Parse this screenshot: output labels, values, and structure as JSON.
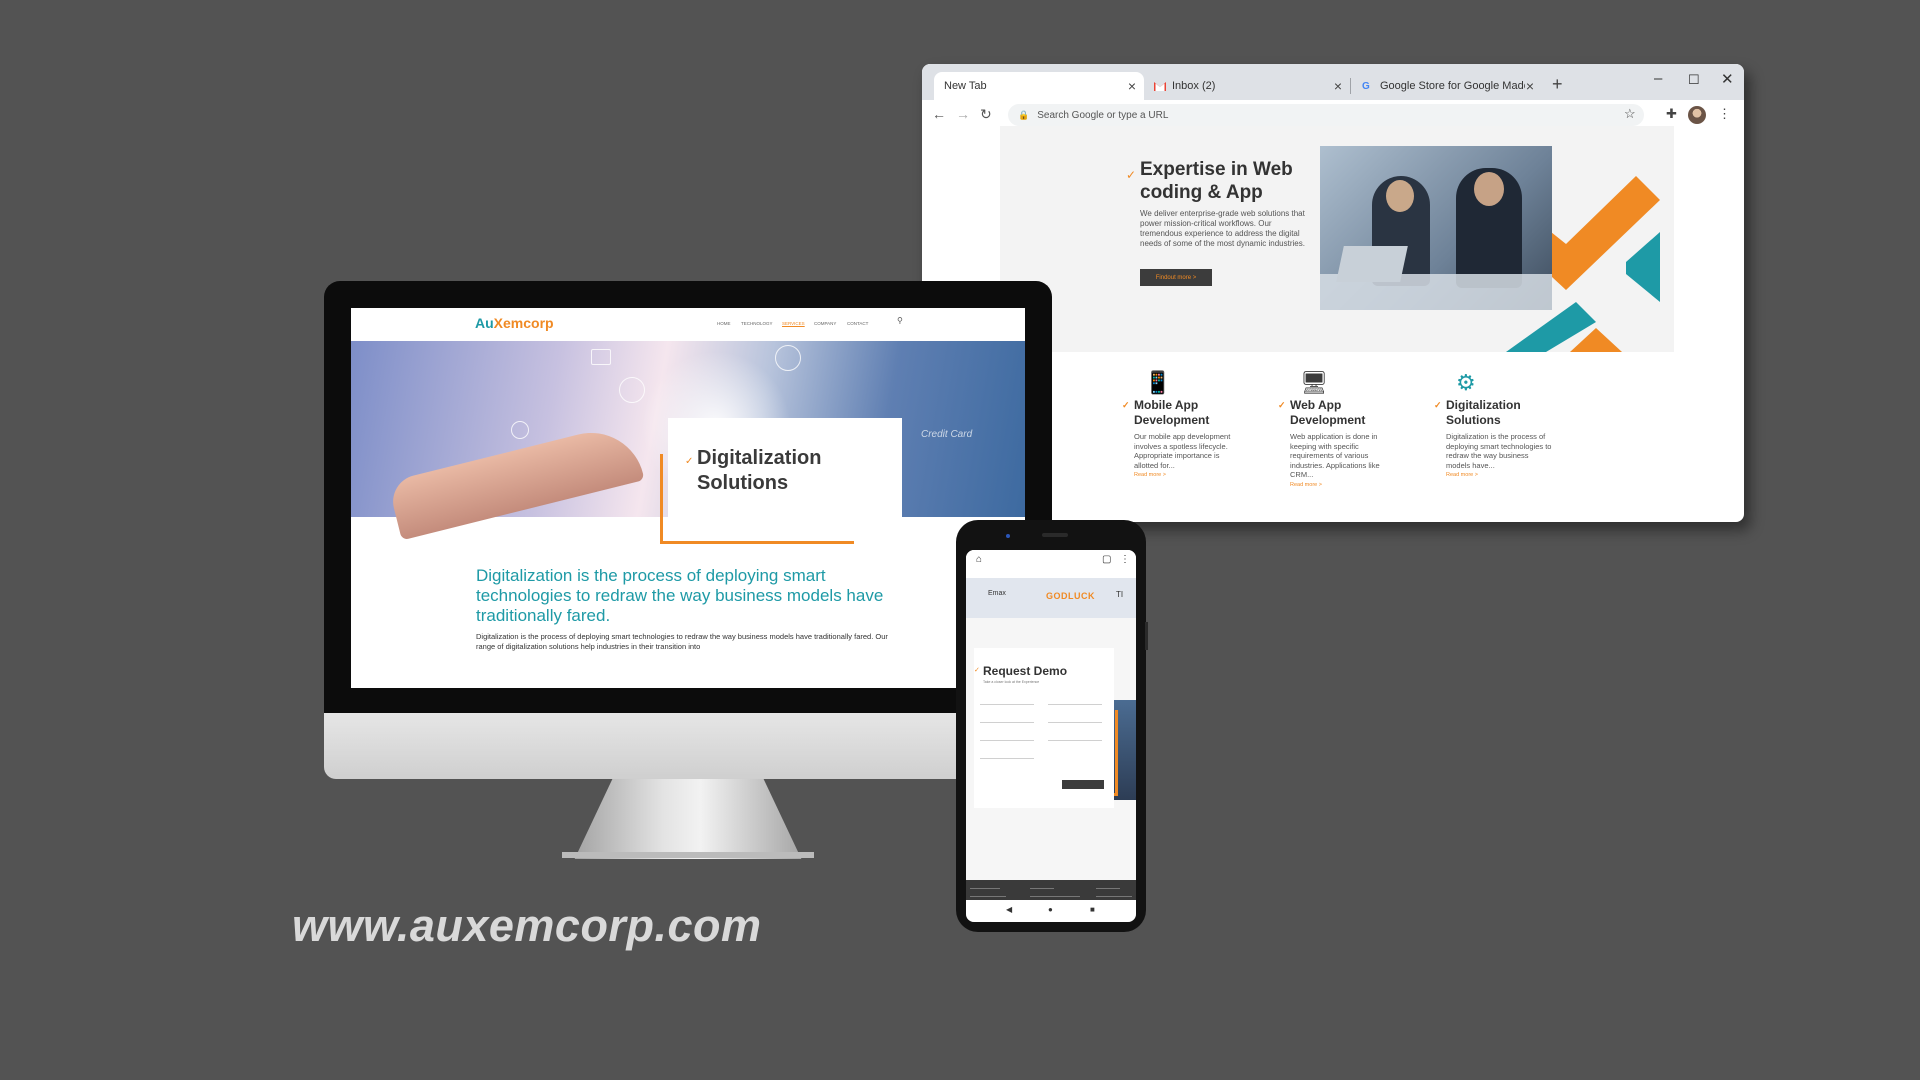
{
  "colors": {
    "background": "#535353",
    "accent_orange": "#f08a24",
    "accent_teal": "#1e9aa6",
    "dark": "#3c3c3c"
  },
  "browser": {
    "tabs": [
      {
        "label": "New Tab",
        "icon": "none"
      },
      {
        "label": "Inbox (2)",
        "icon": "gmail-icon"
      },
      {
        "label": "Google Store for Google Made",
        "icon": "google-icon"
      }
    ],
    "omnibox_placeholder": "Search Google or type a URL",
    "hero": {
      "title": "Expertise in Web coding & App",
      "text": "We deliver enterprise-grade web solutions that power mission-critical workflows. Our tremendous experience to address the digital needs of some of the most dynamic industries.",
      "button": "Findout more >"
    },
    "services": [
      {
        "icon": "mobile-icon",
        "title": "Mobile App Development",
        "text": "Our mobile app development involves a spotless lifecycle. Appropriate importance is allotted for...",
        "more": "Read more >"
      },
      {
        "icon": "monitor-code-icon",
        "title": "Web App Development",
        "text": "Web application is done in keeping with specific requirements of various industries. Applications like CRM...",
        "more": "Read more >"
      },
      {
        "icon": "gear-icon",
        "title": "Digitalization Solutions",
        "text": "Digitalization is the process of deploying smart technologies to redraw the way business models have...",
        "more": "Read more >"
      }
    ]
  },
  "imac": {
    "logo": {
      "prefix": "Au",
      "rest": "Xemcorp"
    },
    "nav": [
      "HOME",
      "TECHNOLOGY",
      "SERVICES",
      "COMPANY",
      "CONTACT"
    ],
    "nav_active": "SERVICES",
    "hero_card_text": "Credit Card",
    "card_title": "Digitalization Solutions",
    "tagline": "Digitalization is the process of deploying smart technologies to redraw the way business models have traditionally fared.",
    "body": "Digitalization is the process of deploying smart technologies to redraw the way business models have traditionally fared. Our range of digitalization solutions help industries in their transition into"
  },
  "phone": {
    "logo1": "Emax",
    "logo2": "GODLUCK",
    "logo3": "TI",
    "form_title": "Request Demo",
    "form_subtitle": "Take a closer look at the Experience"
  },
  "url": "www.auxemcorp.com"
}
